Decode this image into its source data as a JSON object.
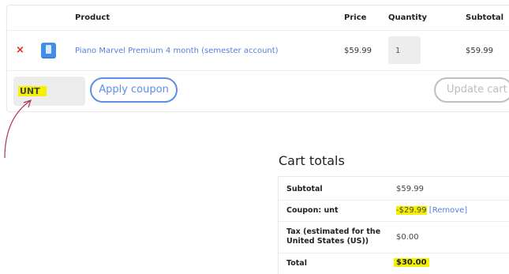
{
  "cart": {
    "headers": {
      "product": "Product",
      "price": "Price",
      "quantity": "Quantity",
      "subtotal": "Subtotal"
    },
    "item": {
      "remove_icon": "×",
      "product": "Piano Marvel Premium 4 month (semester account)",
      "price": "$59.99",
      "quantity": "1",
      "subtotal": "$59.99"
    },
    "coupon_value": "UNT",
    "apply_label": "Apply coupon",
    "update_label": "Update cart"
  },
  "totals": {
    "title": "Cart totals",
    "subtotal_label": "Subtotal",
    "subtotal_value": "$59.99",
    "coupon_label": "Coupon: unt",
    "coupon_value": "-$29.99",
    "remove_label": "[Remove]",
    "tax_label": "Tax (estimated for the United States (US))",
    "tax_value": "$0.00",
    "total_label": "Total",
    "total_value": "$30.00"
  },
  "colors": {
    "accent": "#5b8ee6",
    "highlight": "#f5f000",
    "remove": "#e0261c",
    "annotation": "#b0306a"
  }
}
